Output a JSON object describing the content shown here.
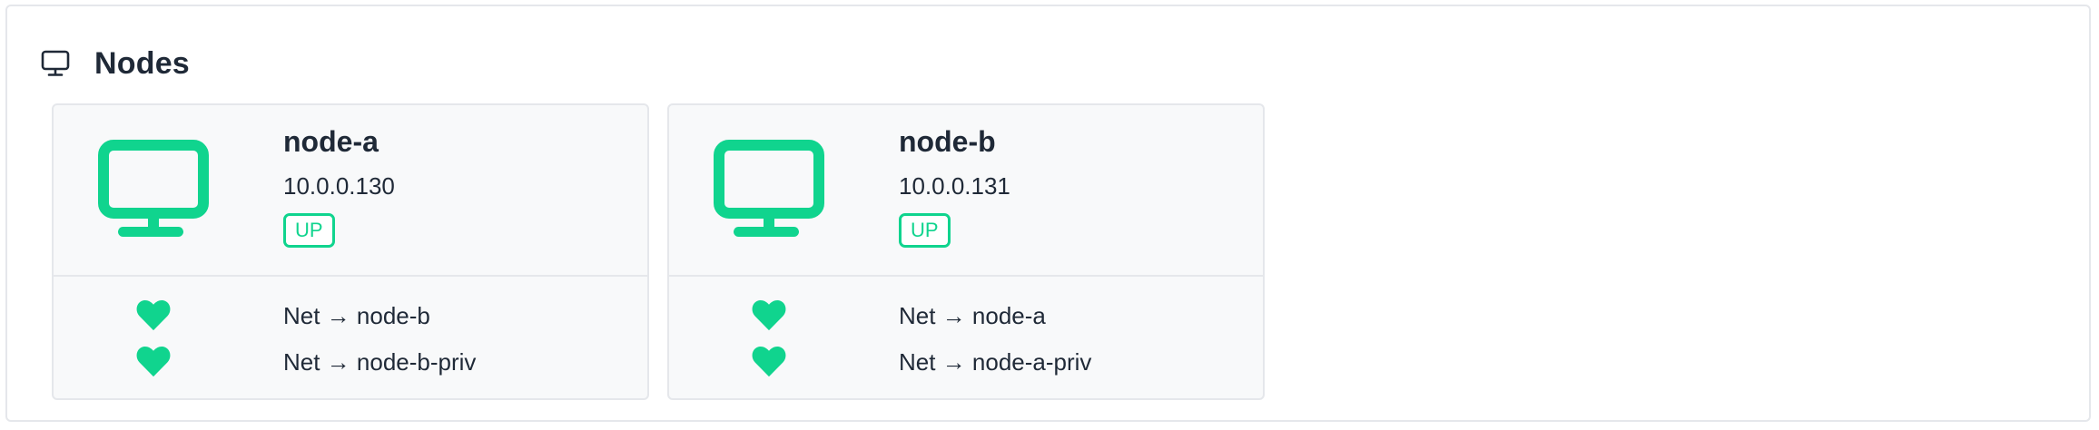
{
  "panel": {
    "title": "Nodes",
    "icon": "monitor-icon"
  },
  "colors": {
    "accent": "#10d48e",
    "text": "#1f2937",
    "border": "#e5e7eb",
    "card_bg": "#f8f9fa"
  },
  "nodes": [
    {
      "name": "node-a",
      "ip": "10.0.0.130",
      "status": "UP",
      "icon": "monitor-icon",
      "links": [
        {
          "icon": "heart-icon",
          "label": "Net → node-b"
        },
        {
          "icon": "heart-icon",
          "label": "Net → node-b-priv"
        }
      ]
    },
    {
      "name": "node-b",
      "ip": "10.0.0.131",
      "status": "UP",
      "icon": "monitor-icon",
      "links": [
        {
          "icon": "heart-icon",
          "label": "Net → node-a"
        },
        {
          "icon": "heart-icon",
          "label": "Net → node-a-priv"
        }
      ]
    }
  ]
}
